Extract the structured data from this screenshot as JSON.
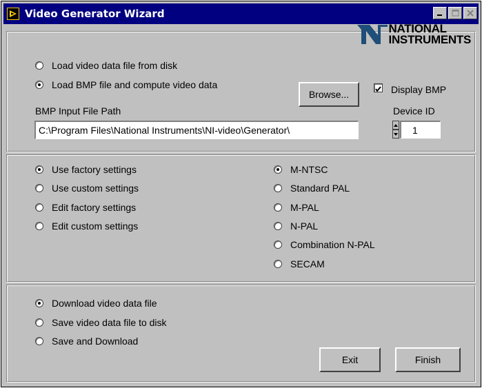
{
  "window": {
    "title": "Video Generator Wizard"
  },
  "brand": {
    "line1": "NATIONAL",
    "line2": "INSTRUMENTS",
    "logo_color": "#1f4e79"
  },
  "source": {
    "options": [
      {
        "label": "Load video data file from disk",
        "selected": false
      },
      {
        "label": "Load BMP file and compute video data",
        "selected": true
      }
    ],
    "browse_label": "Browse...",
    "display_bmp_label": "Display BMP",
    "display_bmp_checked": true,
    "device_id_label": "Device ID",
    "device_id_value": "1",
    "path_label": "BMP Input File Path",
    "path_value": "C:\\Program Files\\National Instruments\\NI-video\\Generator\\"
  },
  "settings": {
    "options": [
      {
        "label": "Use factory settings",
        "selected": true
      },
      {
        "label": "Use custom settings",
        "selected": false
      },
      {
        "label": "Edit factory settings",
        "selected": false
      },
      {
        "label": "Edit custom settings",
        "selected": false
      }
    ]
  },
  "standard": {
    "options": [
      {
        "label": "M-NTSC",
        "selected": true
      },
      {
        "label": "Standard PAL",
        "selected": false
      },
      {
        "label": "M-PAL",
        "selected": false
      },
      {
        "label": "N-PAL",
        "selected": false
      },
      {
        "label": "Combination N-PAL",
        "selected": false
      },
      {
        "label": "SECAM",
        "selected": false
      }
    ]
  },
  "output": {
    "options": [
      {
        "label": "Download video data file",
        "selected": true
      },
      {
        "label": "Save video data file to disk",
        "selected": false
      },
      {
        "label": "Save and Download",
        "selected": false
      }
    ],
    "exit_label": "Exit",
    "finish_label": "Finish"
  },
  "colors": {
    "titlebar": "#000080",
    "face": "#c0c0c0"
  }
}
